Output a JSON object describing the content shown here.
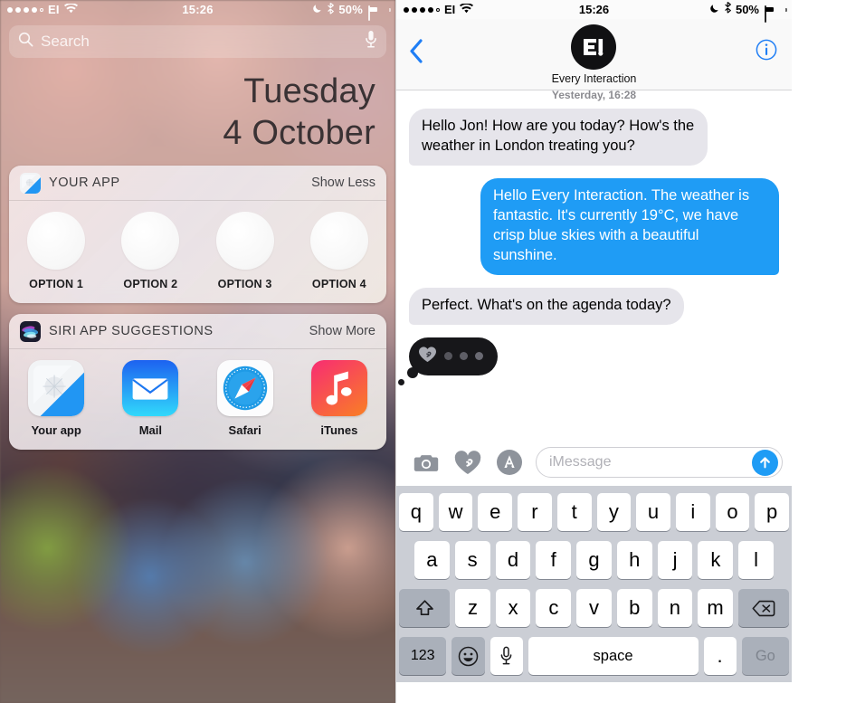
{
  "left_phone": {
    "status_bar": {
      "signal_dots": [
        true,
        true,
        true,
        true,
        false
      ],
      "carrier": "EI",
      "wifi_icon": "wifi-icon",
      "time": "15:26",
      "dnd_icon": "moon-icon",
      "bluetooth_icon": "bluetooth-icon",
      "battery_percent": "50%",
      "battery_level": 50
    },
    "search": {
      "icon": "search-icon",
      "placeholder": "Search",
      "mic_icon": "microphone-icon"
    },
    "date": {
      "weekday": "Tuesday",
      "date": "4 October"
    },
    "widgets": [
      {
        "icon": "your-app-icon",
        "title": "YOUR APP",
        "action": "Show Less",
        "type": "options",
        "options": [
          {
            "label": "OPTION 1"
          },
          {
            "label": "OPTION 2"
          },
          {
            "label": "OPTION 3"
          },
          {
            "label": "OPTION 4"
          }
        ]
      },
      {
        "icon": "siri-icon",
        "title": "SIRI APP SUGGESTIONS",
        "action": "Show More",
        "type": "apps",
        "apps": [
          {
            "label": "Your app",
            "icon": "your-app-icon"
          },
          {
            "label": "Mail",
            "icon": "mail-icon"
          },
          {
            "label": "Safari",
            "icon": "safari-icon"
          },
          {
            "label": "iTunes",
            "icon": "itunes-icon"
          }
        ]
      }
    ]
  },
  "right_phone": {
    "status_bar": {
      "signal_dots": [
        true,
        true,
        true,
        true,
        false
      ],
      "carrier": "EI",
      "wifi_icon": "wifi-icon",
      "time": "15:26",
      "dnd_icon": "moon-icon",
      "bluetooth_icon": "bluetooth-icon",
      "battery_percent": "50%",
      "battery_level": 50
    },
    "header": {
      "back_icon": "back-chevron-icon",
      "avatar_label": "EI",
      "contact_name": "Every Interaction",
      "info_icon": "info-icon"
    },
    "thread": {
      "timestamp": "Yesterday, 16:28",
      "messages": [
        {
          "direction": "in",
          "text": "Hello Jon! How are you today? How's the weather in London treating you?"
        },
        {
          "direction": "out",
          "text": "Hello Every Interaction. The weather is fantastic. It's currently 19°C, we have crisp blue skies with a beautiful sunshine."
        },
        {
          "direction": "in",
          "text": "Perfect. What's on the agenda today?"
        }
      ],
      "typing_indicator": {
        "icon": "digital-touch-heart-icon",
        "dots": 3
      }
    },
    "toolbar": {
      "camera_icon": "camera-icon",
      "digital_touch_icon": "digital-touch-heart-icon",
      "app_store_icon": "app-store-icon",
      "input_placeholder": "iMessage",
      "send_icon": "send-arrow-up-icon"
    },
    "keyboard": {
      "row1": [
        "q",
        "w",
        "e",
        "r",
        "t",
        "y",
        "u",
        "i",
        "o",
        "p"
      ],
      "row2": [
        "a",
        "s",
        "d",
        "f",
        "g",
        "h",
        "j",
        "k",
        "l"
      ],
      "row3": [
        "z",
        "x",
        "c",
        "v",
        "b",
        "n",
        "m"
      ],
      "shift_icon": "shift-arrow-icon",
      "backspace_icon": "backspace-icon",
      "numbers_key": "123",
      "emoji_icon": "emoji-smiley-icon",
      "dictation_icon": "microphone-icon",
      "space_key": "space",
      "period_key": ".",
      "return_key": "Go"
    }
  },
  "colors": {
    "imessage_blue": "#1f9cf5",
    "incoming_grey": "#e6e5eb",
    "keyboard_bg": "#cbced5",
    "key_dark": "#aab0ba",
    "typing_bubble": "#17171a"
  }
}
